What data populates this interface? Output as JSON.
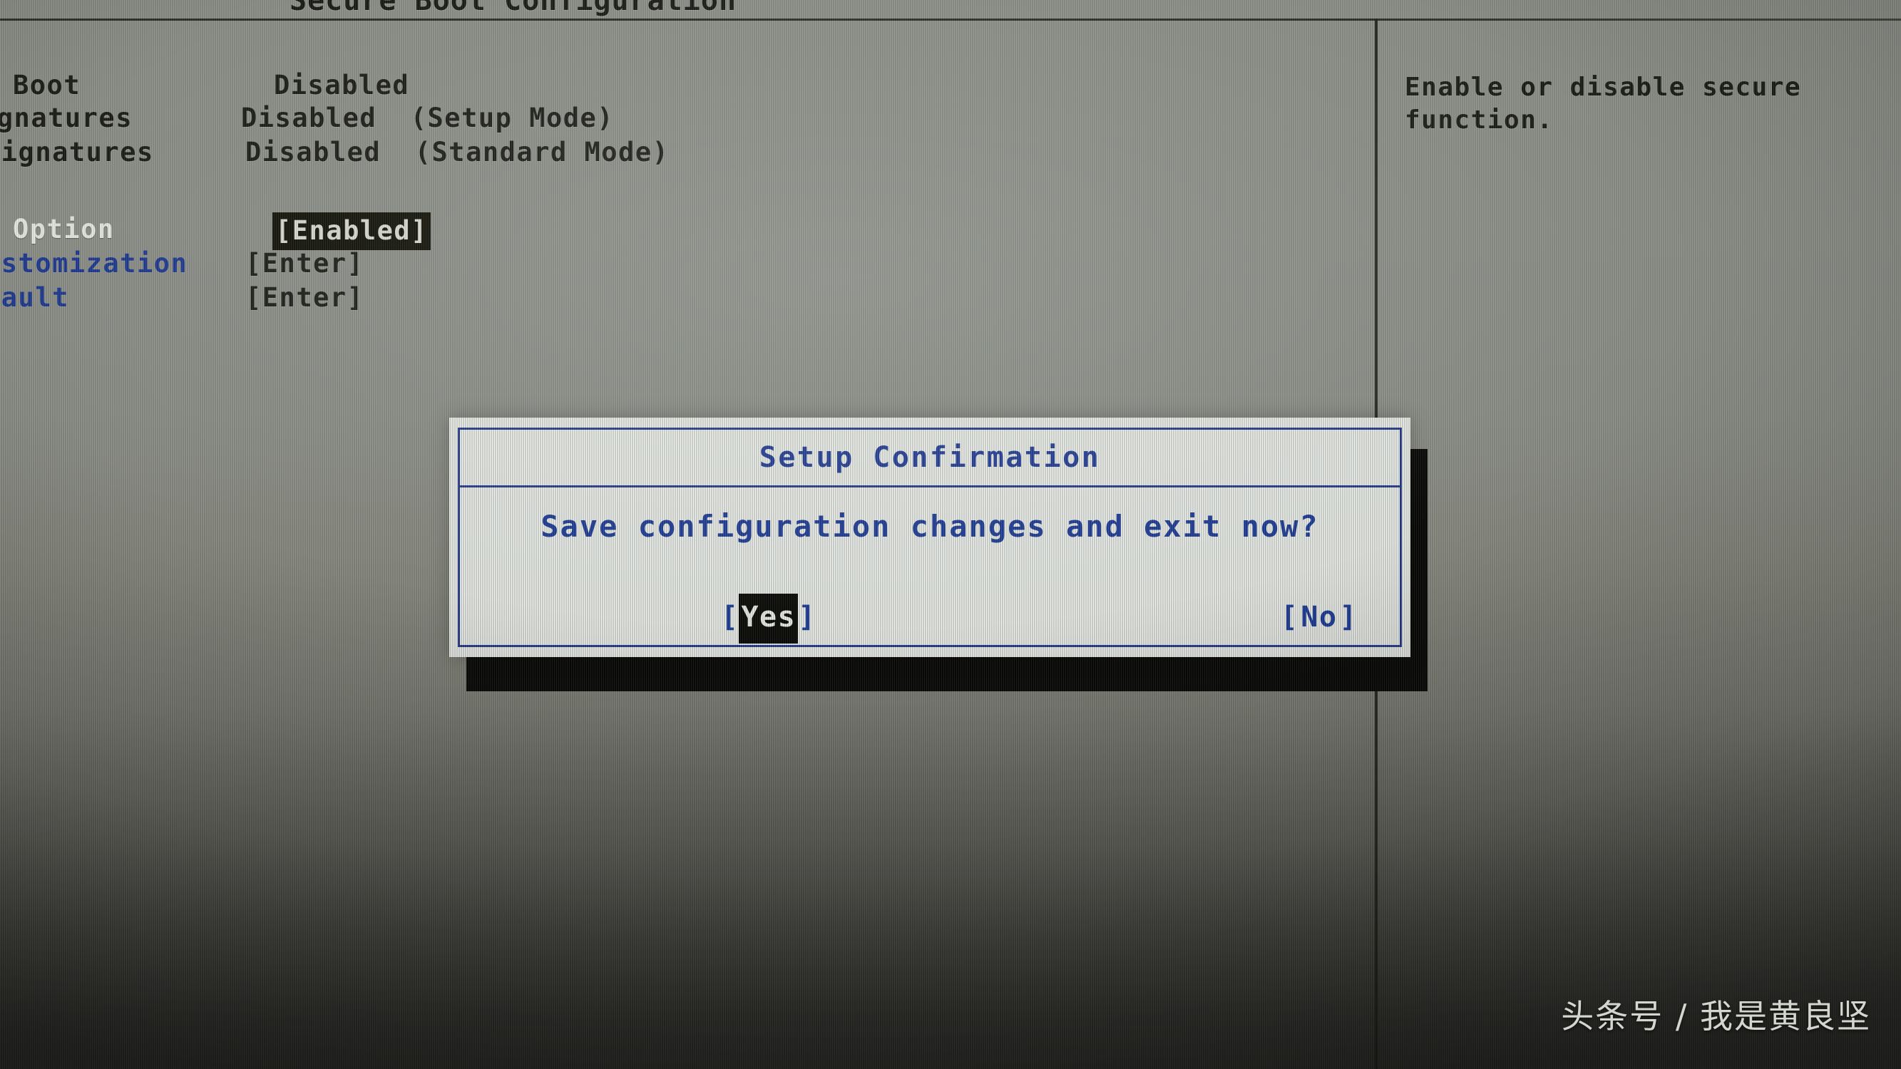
{
  "screen": {
    "page_title": "Secure Boot Configuration",
    "background_color": "#8b8e87",
    "accent_blue": "#22409b",
    "text_dark": "#1c1d18",
    "text_blue": "#1f3a91",
    "text_white": "#e7e9e2",
    "highlight_bg": "#0c0d09"
  },
  "options": [
    {
      "label": "Boot",
      "value": "Disabled",
      "label_color": "dark",
      "value_color": "dark",
      "selected": false
    },
    {
      "label": "ignatures",
      "value": "Disabled  (Setup Mode)",
      "label_color": "dark",
      "value_color": "dark",
      "selected": false
    },
    {
      "label": "Signatures",
      "value": "Disabled  (Standard Mode)",
      "label_color": "dark",
      "value_color": "dark",
      "selected": false
    },
    {
      "label": "Option",
      "value": "[Enabled]",
      "label_color": "white",
      "value_color": "dark",
      "selected": true
    },
    {
      "label": "ustomization",
      "value": "[Enter]",
      "label_color": "blue",
      "value_color": "dark",
      "selected": false
    },
    {
      "label": "fault",
      "value": "[Enter]",
      "label_color": "blue",
      "value_color": "dark",
      "selected": false
    }
  ],
  "help_pane": {
    "lines": [
      "Enable or disable secure",
      "function."
    ]
  },
  "dialog": {
    "title": "Setup Confirmation",
    "message": "Save configuration changes and exit now?",
    "buttons": [
      {
        "label": "Yes",
        "open_bracket": "[",
        "close_bracket": "]",
        "selected": true
      },
      {
        "label": "No",
        "open_bracket": "[",
        "close_bracket": "]",
        "selected": false
      }
    ]
  },
  "watermark": {
    "text": "头条号 / 我是黄良坚"
  }
}
